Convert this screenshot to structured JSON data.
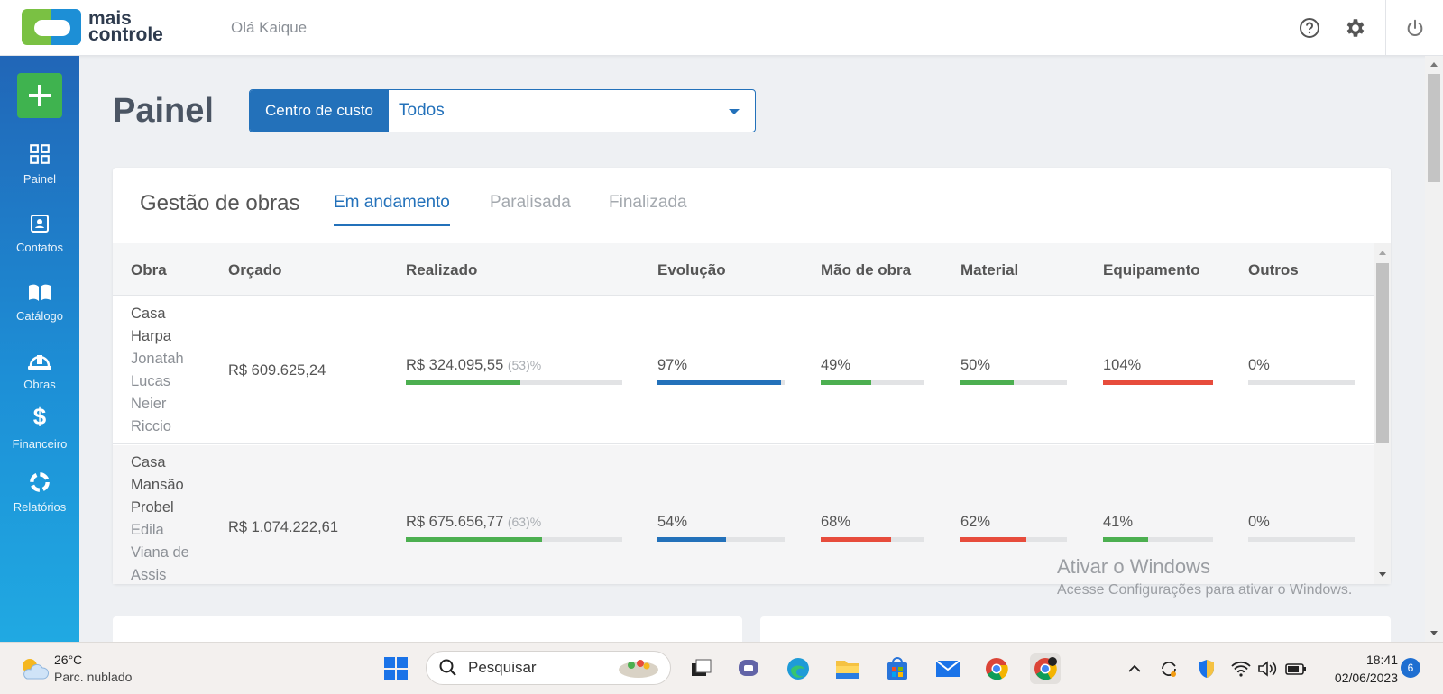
{
  "app": {
    "brand_line1": "mais",
    "brand_line2": "controle",
    "greeting": "Olá Kaique"
  },
  "header": {
    "icons": [
      "help-circle-icon",
      "gear-icon",
      "power-icon"
    ]
  },
  "sidebar": {
    "items": [
      {
        "label": "Painel",
        "icon": "grid-icon"
      },
      {
        "label": "Contatos",
        "icon": "contact-card-icon"
      },
      {
        "label": "Catálogo",
        "icon": "book-icon"
      },
      {
        "label": "Obras",
        "icon": "hard-hat-icon"
      },
      {
        "label": "Financeiro",
        "icon": "dollar-icon"
      },
      {
        "label": "Relatórios",
        "icon": "chart-ring-icon"
      }
    ]
  },
  "page": {
    "title": "Painel"
  },
  "cost_center": {
    "label": "Centro de custo",
    "value": "Todos"
  },
  "card": {
    "title": "Gestão de obras",
    "tabs": [
      "Em andamento",
      "Paralisada",
      "Finalizada"
    ],
    "active_tab": "Em andamento",
    "columns": [
      "Obra",
      "Orçado",
      "Realizado",
      "Evolução",
      "Mão de obra",
      "Material",
      "Equipamento",
      "Outros"
    ],
    "rows": [
      {
        "obra": "Casa Harpa",
        "cliente": "Jonatah Lucas Neier Riccio",
        "orcado": "R$ 609.625,24",
        "realizado": "R$ 324.095,55",
        "realizado_pct": "(53)%",
        "realizado_fill": 53,
        "evolucao": "97%",
        "evolucao_fill": 97,
        "mao_de_obra": "49%",
        "mao_de_obra_fill": 49,
        "material": "50%",
        "material_fill": 50,
        "equipamento": "104%",
        "equipamento_fill": 100,
        "outros": "0%",
        "outros_fill": 0
      },
      {
        "obra": "Casa Mansão Probel",
        "cliente": "Edila Viana de Assis",
        "orcado": "R$ 1.074.222,61",
        "realizado": "R$ 675.656,77",
        "realizado_pct": "(63)%",
        "realizado_fill": 63,
        "evolucao": "54%",
        "evolucao_fill": 54,
        "mao_de_obra": "68%",
        "mao_de_obra_fill": 68,
        "material": "62%",
        "material_fill": 62,
        "equipamento": "41%",
        "equipamento_fill": 41,
        "outros": "0%",
        "outros_fill": 0
      }
    ]
  },
  "colors": {
    "primary": "#2371ba",
    "green": "#4caf50",
    "red": "#e74c3c",
    "blue_bar": "#2371ba"
  },
  "watermark": {
    "line1": "Ativar o Windows",
    "line2": "Acesse Configurações para ativar o Windows."
  },
  "taskbar": {
    "weather_temp": "26°C",
    "weather_desc": "Parc. nublado",
    "search_placeholder": "Pesquisar",
    "time": "18:41",
    "date": "02/06/2023",
    "notifications": "6"
  }
}
